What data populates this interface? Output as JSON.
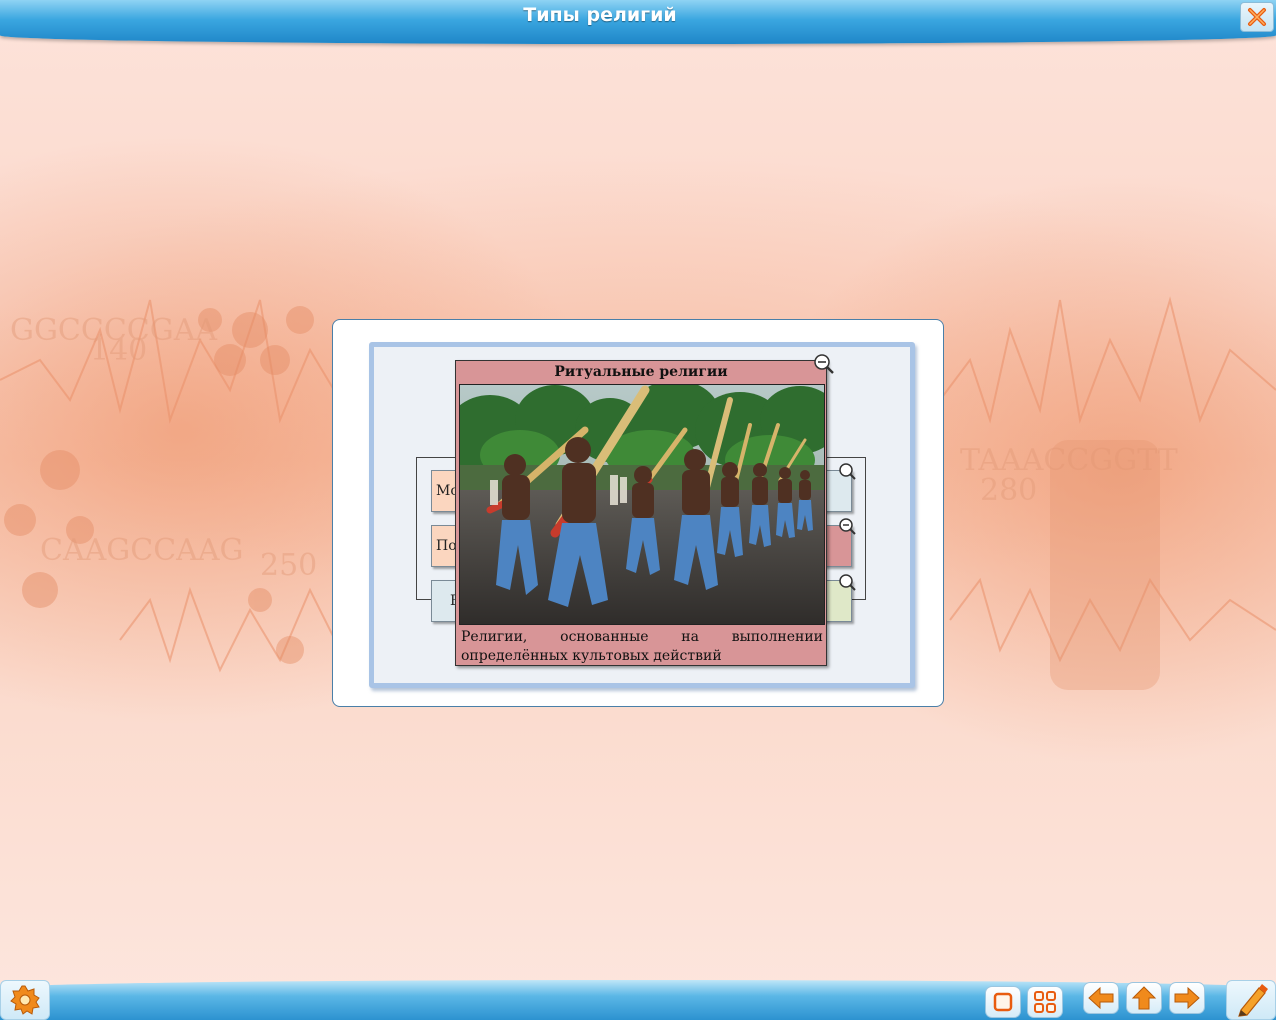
{
  "window": {
    "title": "Типы религий",
    "close_icon": "close-x-icon"
  },
  "diagram": {
    "left_items": [
      {
        "label": "Мо",
        "color": "#fbd6bf"
      },
      {
        "label": "По",
        "color": "#fbd6bf"
      },
      {
        "label": "В",
        "color": "#dde9ee"
      }
    ],
    "right_items": [
      {
        "label": "",
        "color": "#dde9ee"
      },
      {
        "label": "",
        "color": "#d89597"
      },
      {
        "label": "",
        "color": "#dfe8c8"
      }
    ]
  },
  "popup": {
    "title": "Ритуальные религии",
    "caption": "Религии, основанные на выполнении определённых культовых действий",
    "image": "procession-photo",
    "zoom_icon": "zoom-out-icon"
  },
  "toolbar": {
    "settings_icon": "gear-icon",
    "buttons": [
      {
        "name": "window-button",
        "icon": "window-icon"
      },
      {
        "name": "grid-button",
        "icon": "grid-icon"
      },
      {
        "name": "back-button",
        "icon": "arrow-left-icon"
      },
      {
        "name": "up-button",
        "icon": "arrow-up-icon"
      },
      {
        "name": "forward-button",
        "icon": "arrow-right-icon"
      },
      {
        "name": "pencil-button",
        "icon": "pencil-icon"
      }
    ]
  },
  "colors": {
    "accent": "#1f86c8",
    "popup_bg": "#d89597"
  }
}
